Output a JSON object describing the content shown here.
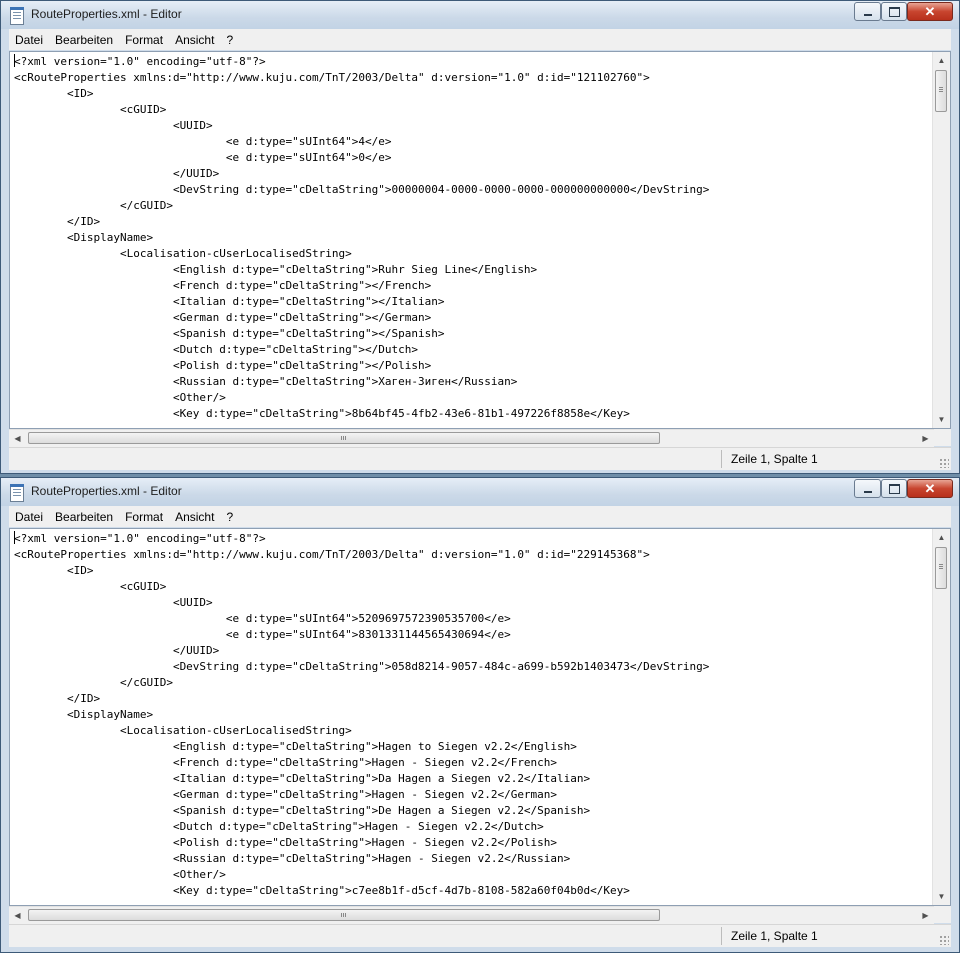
{
  "windows": [
    {
      "title": "RouteProperties.xml - Editor",
      "menu": [
        "Datei",
        "Bearbeiten",
        "Format",
        "Ansicht",
        "?"
      ],
      "lines": [
        "<?xml version=\"1.0\" encoding=\"utf-8\"?>",
        "<cRouteProperties xmlns:d=\"http://www.kuju.com/TnT/2003/Delta\" d:version=\"1.0\" d:id=\"121102760\">",
        "\t<ID>",
        "\t\t<cGUID>",
        "\t\t\t<UUID>",
        "\t\t\t\t<e d:type=\"sUInt64\">4</e>",
        "\t\t\t\t<e d:type=\"sUInt64\">0</e>",
        "\t\t\t</UUID>",
        "\t\t\t<DevString d:type=\"cDeltaString\">00000004-0000-0000-0000-000000000000</DevString>",
        "\t\t</cGUID>",
        "\t</ID>",
        "\t<DisplayName>",
        "\t\t<Localisation-cUserLocalisedString>",
        "\t\t\t<English d:type=\"cDeltaString\">Ruhr Sieg Line</English>",
        "\t\t\t<French d:type=\"cDeltaString\"></French>",
        "\t\t\t<Italian d:type=\"cDeltaString\"></Italian>",
        "\t\t\t<German d:type=\"cDeltaString\"></German>",
        "\t\t\t<Spanish d:type=\"cDeltaString\"></Spanish>",
        "\t\t\t<Dutch d:type=\"cDeltaString\"></Dutch>",
        "\t\t\t<Polish d:type=\"cDeltaString\"></Polish>",
        "\t\t\t<Russian d:type=\"cDeltaString\">Хаген-Зиген</Russian>",
        "\t\t\t<Other/>",
        "\t\t\t<Key d:type=\"cDeltaString\">8b64bf45-4fb2-43e6-81b1-497226f8858e</Key>"
      ],
      "status": "Zeile 1, Spalte 1"
    },
    {
      "title": "RouteProperties.xml - Editor",
      "menu": [
        "Datei",
        "Bearbeiten",
        "Format",
        "Ansicht",
        "?"
      ],
      "lines": [
        "<?xml version=\"1.0\" encoding=\"utf-8\"?>",
        "<cRouteProperties xmlns:d=\"http://www.kuju.com/TnT/2003/Delta\" d:version=\"1.0\" d:id=\"229145368\">",
        "\t<ID>",
        "\t\t<cGUID>",
        "\t\t\t<UUID>",
        "\t\t\t\t<e d:type=\"sUInt64\">5209697572390535700</e>",
        "\t\t\t\t<e d:type=\"sUInt64\">8301331144565430694</e>",
        "\t\t\t</UUID>",
        "\t\t\t<DevString d:type=\"cDeltaString\">058d8214-9057-484c-a699-b592b1403473</DevString>",
        "\t\t</cGUID>",
        "\t</ID>",
        "\t<DisplayName>",
        "\t\t<Localisation-cUserLocalisedString>",
        "\t\t\t<English d:type=\"cDeltaString\">Hagen to Siegen v2.2</English>",
        "\t\t\t<French d:type=\"cDeltaString\">Hagen - Siegen v2.2</French>",
        "\t\t\t<Italian d:type=\"cDeltaString\">Da Hagen a Siegen v2.2</Italian>",
        "\t\t\t<German d:type=\"cDeltaString\">Hagen - Siegen v2.2</German>",
        "\t\t\t<Spanish d:type=\"cDeltaString\">De Hagen a Siegen v2.2</Spanish>",
        "\t\t\t<Dutch d:type=\"cDeltaString\">Hagen - Siegen v2.2</Dutch>",
        "\t\t\t<Polish d:type=\"cDeltaString\">Hagen - Siegen v2.2</Polish>",
        "\t\t\t<Russian d:type=\"cDeltaString\">Hagen - Siegen v2.2</Russian>",
        "\t\t\t<Other/>",
        "\t\t\t<Key d:type=\"cDeltaString\">c7ee8b1f-d5cf-4d7b-8108-582a60f04b0d</Key>"
      ],
      "status": "Zeile 1, Spalte 1"
    }
  ]
}
